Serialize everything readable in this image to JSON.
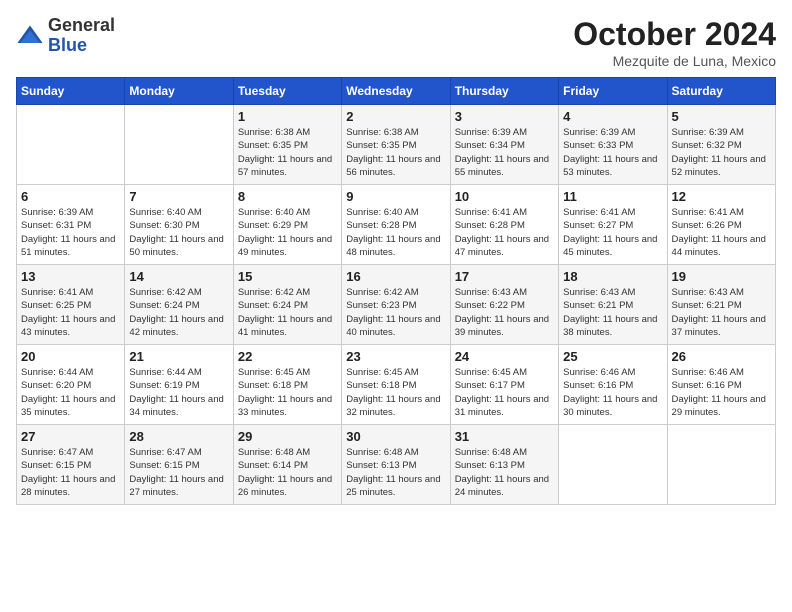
{
  "logo": {
    "general": "General",
    "blue": "Blue"
  },
  "title": "October 2024",
  "subtitle": "Mezquite de Luna, Mexico",
  "days_of_week": [
    "Sunday",
    "Monday",
    "Tuesday",
    "Wednesday",
    "Thursday",
    "Friday",
    "Saturday"
  ],
  "weeks": [
    [
      {
        "day": "",
        "info": ""
      },
      {
        "day": "",
        "info": ""
      },
      {
        "day": "1",
        "info": "Sunrise: 6:38 AM\nSunset: 6:35 PM\nDaylight: 11 hours and 57 minutes."
      },
      {
        "day": "2",
        "info": "Sunrise: 6:38 AM\nSunset: 6:35 PM\nDaylight: 11 hours and 56 minutes."
      },
      {
        "day": "3",
        "info": "Sunrise: 6:39 AM\nSunset: 6:34 PM\nDaylight: 11 hours and 55 minutes."
      },
      {
        "day": "4",
        "info": "Sunrise: 6:39 AM\nSunset: 6:33 PM\nDaylight: 11 hours and 53 minutes."
      },
      {
        "day": "5",
        "info": "Sunrise: 6:39 AM\nSunset: 6:32 PM\nDaylight: 11 hours and 52 minutes."
      }
    ],
    [
      {
        "day": "6",
        "info": "Sunrise: 6:39 AM\nSunset: 6:31 PM\nDaylight: 11 hours and 51 minutes."
      },
      {
        "day": "7",
        "info": "Sunrise: 6:40 AM\nSunset: 6:30 PM\nDaylight: 11 hours and 50 minutes."
      },
      {
        "day": "8",
        "info": "Sunrise: 6:40 AM\nSunset: 6:29 PM\nDaylight: 11 hours and 49 minutes."
      },
      {
        "day": "9",
        "info": "Sunrise: 6:40 AM\nSunset: 6:28 PM\nDaylight: 11 hours and 48 minutes."
      },
      {
        "day": "10",
        "info": "Sunrise: 6:41 AM\nSunset: 6:28 PM\nDaylight: 11 hours and 47 minutes."
      },
      {
        "day": "11",
        "info": "Sunrise: 6:41 AM\nSunset: 6:27 PM\nDaylight: 11 hours and 45 minutes."
      },
      {
        "day": "12",
        "info": "Sunrise: 6:41 AM\nSunset: 6:26 PM\nDaylight: 11 hours and 44 minutes."
      }
    ],
    [
      {
        "day": "13",
        "info": "Sunrise: 6:41 AM\nSunset: 6:25 PM\nDaylight: 11 hours and 43 minutes."
      },
      {
        "day": "14",
        "info": "Sunrise: 6:42 AM\nSunset: 6:24 PM\nDaylight: 11 hours and 42 minutes."
      },
      {
        "day": "15",
        "info": "Sunrise: 6:42 AM\nSunset: 6:24 PM\nDaylight: 11 hours and 41 minutes."
      },
      {
        "day": "16",
        "info": "Sunrise: 6:42 AM\nSunset: 6:23 PM\nDaylight: 11 hours and 40 minutes."
      },
      {
        "day": "17",
        "info": "Sunrise: 6:43 AM\nSunset: 6:22 PM\nDaylight: 11 hours and 39 minutes."
      },
      {
        "day": "18",
        "info": "Sunrise: 6:43 AM\nSunset: 6:21 PM\nDaylight: 11 hours and 38 minutes."
      },
      {
        "day": "19",
        "info": "Sunrise: 6:43 AM\nSunset: 6:21 PM\nDaylight: 11 hours and 37 minutes."
      }
    ],
    [
      {
        "day": "20",
        "info": "Sunrise: 6:44 AM\nSunset: 6:20 PM\nDaylight: 11 hours and 35 minutes."
      },
      {
        "day": "21",
        "info": "Sunrise: 6:44 AM\nSunset: 6:19 PM\nDaylight: 11 hours and 34 minutes."
      },
      {
        "day": "22",
        "info": "Sunrise: 6:45 AM\nSunset: 6:18 PM\nDaylight: 11 hours and 33 minutes."
      },
      {
        "day": "23",
        "info": "Sunrise: 6:45 AM\nSunset: 6:18 PM\nDaylight: 11 hours and 32 minutes."
      },
      {
        "day": "24",
        "info": "Sunrise: 6:45 AM\nSunset: 6:17 PM\nDaylight: 11 hours and 31 minutes."
      },
      {
        "day": "25",
        "info": "Sunrise: 6:46 AM\nSunset: 6:16 PM\nDaylight: 11 hours and 30 minutes."
      },
      {
        "day": "26",
        "info": "Sunrise: 6:46 AM\nSunset: 6:16 PM\nDaylight: 11 hours and 29 minutes."
      }
    ],
    [
      {
        "day": "27",
        "info": "Sunrise: 6:47 AM\nSunset: 6:15 PM\nDaylight: 11 hours and 28 minutes."
      },
      {
        "day": "28",
        "info": "Sunrise: 6:47 AM\nSunset: 6:15 PM\nDaylight: 11 hours and 27 minutes."
      },
      {
        "day": "29",
        "info": "Sunrise: 6:48 AM\nSunset: 6:14 PM\nDaylight: 11 hours and 26 minutes."
      },
      {
        "day": "30",
        "info": "Sunrise: 6:48 AM\nSunset: 6:13 PM\nDaylight: 11 hours and 25 minutes."
      },
      {
        "day": "31",
        "info": "Sunrise: 6:48 AM\nSunset: 6:13 PM\nDaylight: 11 hours and 24 minutes."
      },
      {
        "day": "",
        "info": ""
      },
      {
        "day": "",
        "info": ""
      }
    ]
  ]
}
